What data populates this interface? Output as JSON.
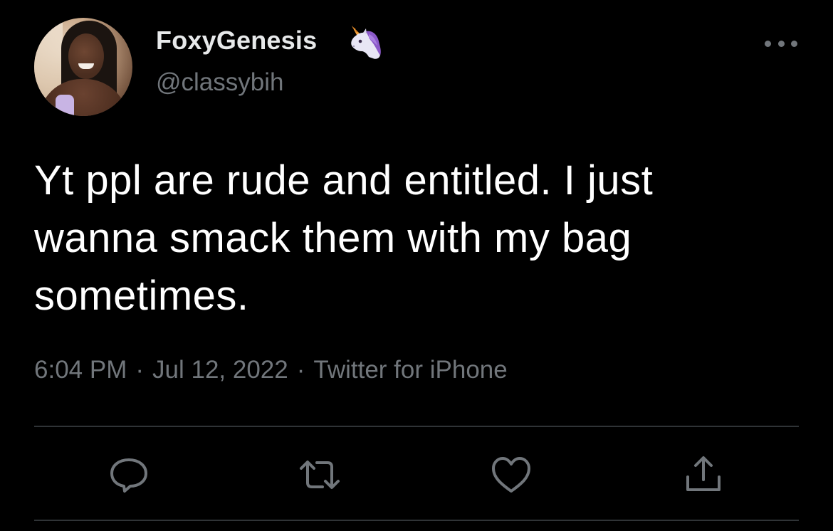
{
  "tweet": {
    "display_name": "FoxyGenesis",
    "name_emoji": "unicorn-icon",
    "handle": "@classybih",
    "text": "Yt ppl are rude and entitled. I just wanna smack them with my bag sometimes.",
    "time": "6:04 PM",
    "date": "Jul 12, 2022",
    "source": "Twitter for iPhone",
    "separator": "·"
  },
  "actions": [
    {
      "icon": "reply-icon"
    },
    {
      "icon": "retweet-icon"
    },
    {
      "icon": "like-icon"
    },
    {
      "icon": "share-icon"
    }
  ],
  "colors": {
    "background": "#000000",
    "text_primary": "#ffffff",
    "text_secondary": "#71767b",
    "divider": "#2f3336"
  }
}
